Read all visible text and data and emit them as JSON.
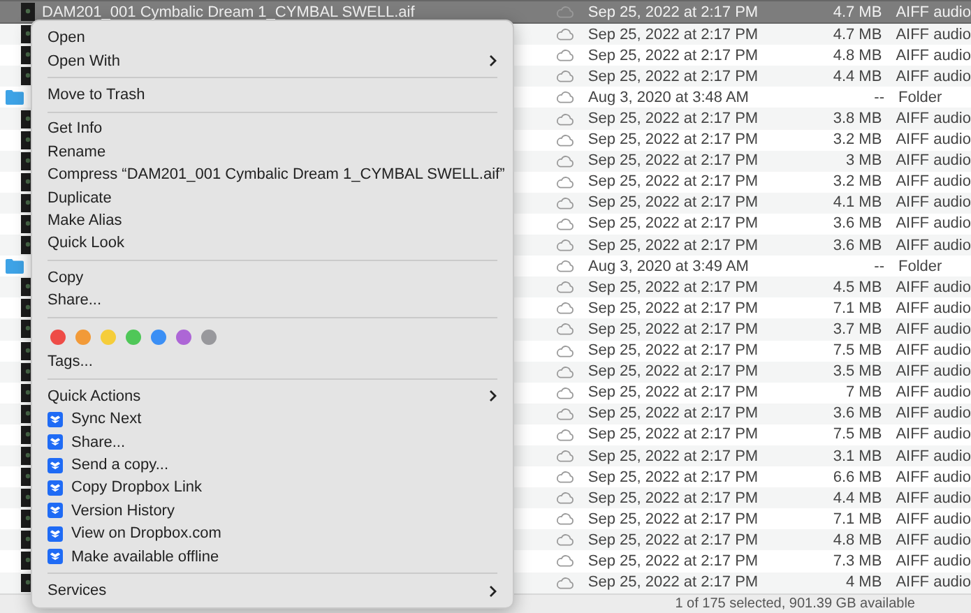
{
  "files": [
    {
      "kind": "audio",
      "name": "DAM201_001 Cymbalic Dream 1_CYMBAL SWELL.aif",
      "date": "Sep 25, 2022 at 2:17 PM",
      "size": "4.7 MB",
      "type": "AIFF audio",
      "selected": true
    },
    {
      "kind": "audio",
      "date": "Sep 25, 2022 at 2:17 PM",
      "size": "4.7 MB",
      "type": "AIFF audio",
      "selected": false
    },
    {
      "kind": "audio",
      "date": "Sep 25, 2022 at 2:17 PM",
      "size": "4.8 MB",
      "type": "AIFF audio",
      "selected": false
    },
    {
      "kind": "audio",
      "date": "Sep 25, 2022 at 2:17 PM",
      "size": "4.4 MB",
      "type": "AIFF audio",
      "selected": false
    },
    {
      "kind": "folder",
      "date": "Aug 3, 2020 at 3:48 AM",
      "size": "--",
      "type": "Folder",
      "selected": false
    },
    {
      "kind": "audio",
      "date": "Sep 25, 2022 at 2:17 PM",
      "size": "3.8 MB",
      "type": "AIFF audio",
      "selected": false
    },
    {
      "kind": "audio",
      "date": "Sep 25, 2022 at 2:17 PM",
      "size": "3.2 MB",
      "type": "AIFF audio",
      "selected": false
    },
    {
      "kind": "audio",
      "date": "Sep 25, 2022 at 2:17 PM",
      "size": "3 MB",
      "type": "AIFF audio",
      "selected": false
    },
    {
      "kind": "audio",
      "date": "Sep 25, 2022 at 2:17 PM",
      "size": "3.2 MB",
      "type": "AIFF audio",
      "selected": false
    },
    {
      "kind": "audio",
      "date": "Sep 25, 2022 at 2:17 PM",
      "size": "4.1 MB",
      "type": "AIFF audio",
      "selected": false
    },
    {
      "kind": "audio",
      "date": "Sep 25, 2022 at 2:17 PM",
      "size": "3.6 MB",
      "type": "AIFF audio",
      "selected": false
    },
    {
      "kind": "audio",
      "date": "Sep 25, 2022 at 2:17 PM",
      "size": "3.6 MB",
      "type": "AIFF audio",
      "selected": false
    },
    {
      "kind": "folder",
      "date": "Aug 3, 2020 at 3:49 AM",
      "size": "--",
      "type": "Folder",
      "selected": false
    },
    {
      "kind": "audio",
      "date": "Sep 25, 2022 at 2:17 PM",
      "size": "4.5 MB",
      "type": "AIFF audio",
      "selected": false
    },
    {
      "kind": "audio",
      "date": "Sep 25, 2022 at 2:17 PM",
      "size": "7.1 MB",
      "type": "AIFF audio",
      "selected": false
    },
    {
      "kind": "audio",
      "date": "Sep 25, 2022 at 2:17 PM",
      "size": "3.7 MB",
      "type": "AIFF audio",
      "selected": false
    },
    {
      "kind": "audio",
      "date": "Sep 25, 2022 at 2:17 PM",
      "size": "7.5 MB",
      "type": "AIFF audio",
      "selected": false
    },
    {
      "kind": "audio",
      "date": "Sep 25, 2022 at 2:17 PM",
      "size": "3.5 MB",
      "type": "AIFF audio",
      "selected": false
    },
    {
      "kind": "audio",
      "date": "Sep 25, 2022 at 2:17 PM",
      "size": "7 MB",
      "type": "AIFF audio",
      "selected": false
    },
    {
      "kind": "audio",
      "date": "Sep 25, 2022 at 2:17 PM",
      "size": "3.6 MB",
      "type": "AIFF audio",
      "selected": false
    },
    {
      "kind": "audio",
      "date": "Sep 25, 2022 at 2:17 PM",
      "size": "7.5 MB",
      "type": "AIFF audio",
      "selected": false
    },
    {
      "kind": "audio",
      "date": "Sep 25, 2022 at 2:17 PM",
      "size": "3.1 MB",
      "type": "AIFF audio",
      "selected": false
    },
    {
      "kind": "audio",
      "date": "Sep 25, 2022 at 2:17 PM",
      "size": "6.6 MB",
      "type": "AIFF audio",
      "selected": false
    },
    {
      "kind": "audio",
      "date": "Sep 25, 2022 at 2:17 PM",
      "size": "4.4 MB",
      "type": "AIFF audio",
      "selected": false
    },
    {
      "kind": "audio",
      "date": "Sep 25, 2022 at 2:17 PM",
      "size": "7.1 MB",
      "type": "AIFF audio",
      "selected": false
    },
    {
      "kind": "audio",
      "date": "Sep 25, 2022 at 2:17 PM",
      "size": "4.8 MB",
      "type": "AIFF audio",
      "selected": false
    },
    {
      "kind": "audio",
      "date": "Sep 25, 2022 at 2:17 PM",
      "size": "7.3 MB",
      "type": "AIFF audio",
      "selected": false
    },
    {
      "kind": "audio",
      "date": "Sep 25, 2022 at 2:17 PM",
      "size": "4 MB",
      "type": "AIFF audio",
      "selected": false
    }
  ],
  "status_bar": "1 of 175 selected, 901.39 GB available",
  "context_menu": [
    {
      "kind": "item",
      "label": "Open"
    },
    {
      "kind": "submenu",
      "label": "Open With"
    },
    {
      "kind": "separator"
    },
    {
      "kind": "item",
      "label": "Move to Trash"
    },
    {
      "kind": "separator"
    },
    {
      "kind": "item",
      "label": "Get Info"
    },
    {
      "kind": "item",
      "label": "Rename"
    },
    {
      "kind": "item",
      "label": "Compress “DAM201_001 Cymbalic Dream 1_CYMBAL SWELL.aif”"
    },
    {
      "kind": "item",
      "label": "Duplicate"
    },
    {
      "kind": "item",
      "label": "Make Alias"
    },
    {
      "kind": "item",
      "label": "Quick Look"
    },
    {
      "kind": "separator"
    },
    {
      "kind": "item",
      "label": "Copy"
    },
    {
      "kind": "item",
      "label": "Share..."
    },
    {
      "kind": "separator"
    },
    {
      "kind": "tags",
      "colors": [
        {
          "color": "#ee4c47"
        },
        {
          "color": "#f29a38"
        },
        {
          "color": "#f5cd3a"
        },
        {
          "color": "#4fc758"
        },
        {
          "color": "#3b8ff5"
        },
        {
          "color": "#ad66d6"
        },
        {
          "color": "#98989c"
        }
      ]
    },
    {
      "kind": "item",
      "label": "Tags..."
    },
    {
      "kind": "separator"
    },
    {
      "kind": "submenu",
      "label": "Quick Actions"
    },
    {
      "kind": "dropbox",
      "label": "Sync Next"
    },
    {
      "kind": "dropbox",
      "label": "Share..."
    },
    {
      "kind": "dropbox",
      "label": "Send a copy..."
    },
    {
      "kind": "dropbox",
      "label": "Copy Dropbox Link"
    },
    {
      "kind": "dropbox",
      "label": "Version History"
    },
    {
      "kind": "dropbox",
      "label": "View on Dropbox.com"
    },
    {
      "kind": "dropbox",
      "label": "Make available offline"
    },
    {
      "kind": "separator"
    },
    {
      "kind": "submenu",
      "label": "Services"
    }
  ]
}
